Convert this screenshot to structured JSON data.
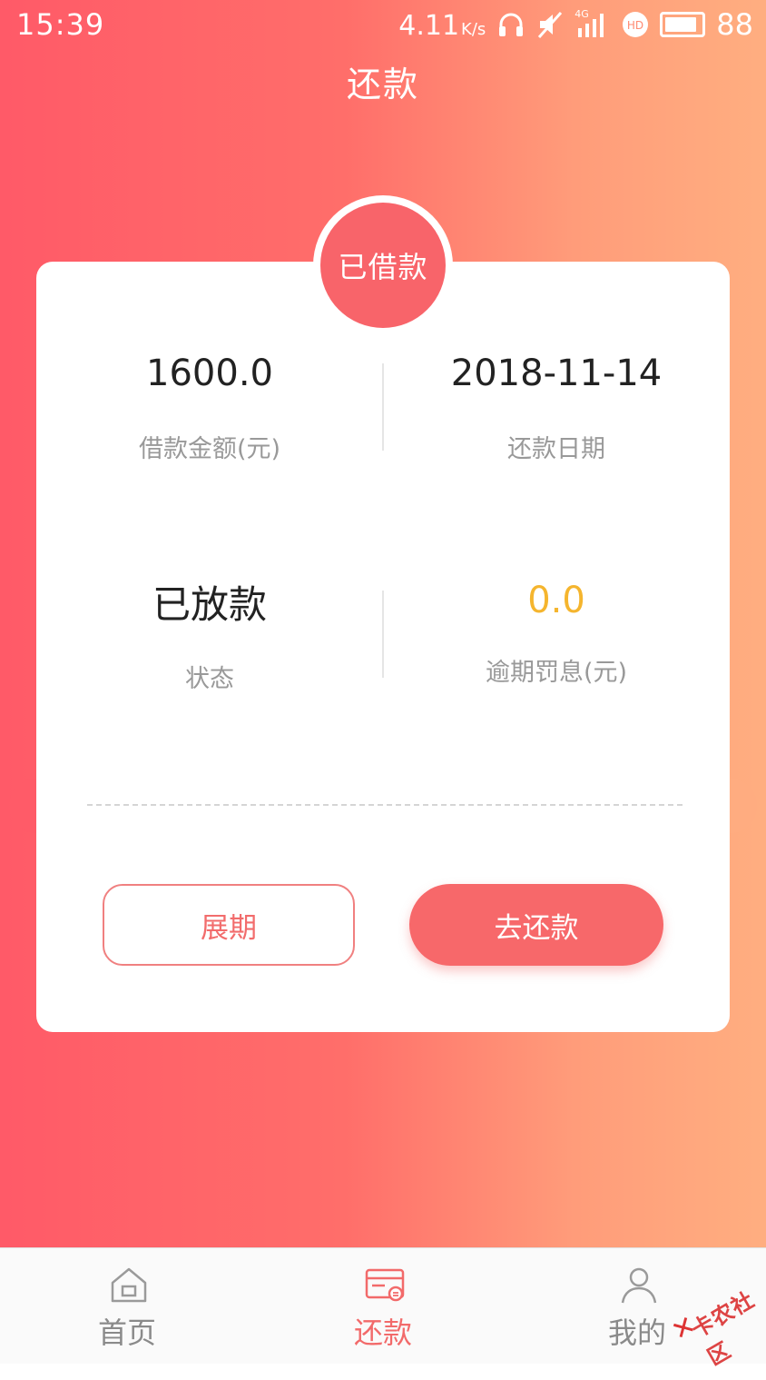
{
  "status_bar": {
    "time": "15:39",
    "net_speed": "4.11",
    "net_unit": "K/s",
    "network_label": "4G",
    "battery": "88"
  },
  "header": {
    "title": "还款"
  },
  "card": {
    "badge": "已借款",
    "loan_amount": {
      "value": "1600.0",
      "label": "借款金额(元)"
    },
    "repay_date": {
      "value": "2018-11-14",
      "label": "还款日期"
    },
    "status": {
      "value": "已放款",
      "label": "状态"
    },
    "penalty": {
      "value": "0.0",
      "label": "逾期罚息(元)"
    },
    "extend_button": "展期",
    "repay_button": "去还款"
  },
  "tabbar": {
    "items": [
      {
        "label": "首页",
        "icon": "home-icon"
      },
      {
        "label": "还款",
        "icon": "repay-icon",
        "active": true
      },
      {
        "label": "我的",
        "icon": "user-icon"
      }
    ]
  },
  "watermark": {
    "text": "卡农社区"
  },
  "colors": {
    "accent": "#f7686a",
    "penalty": "#f5b52e",
    "gradient_start": "#ff5a68",
    "gradient_end": "#ffae80"
  }
}
